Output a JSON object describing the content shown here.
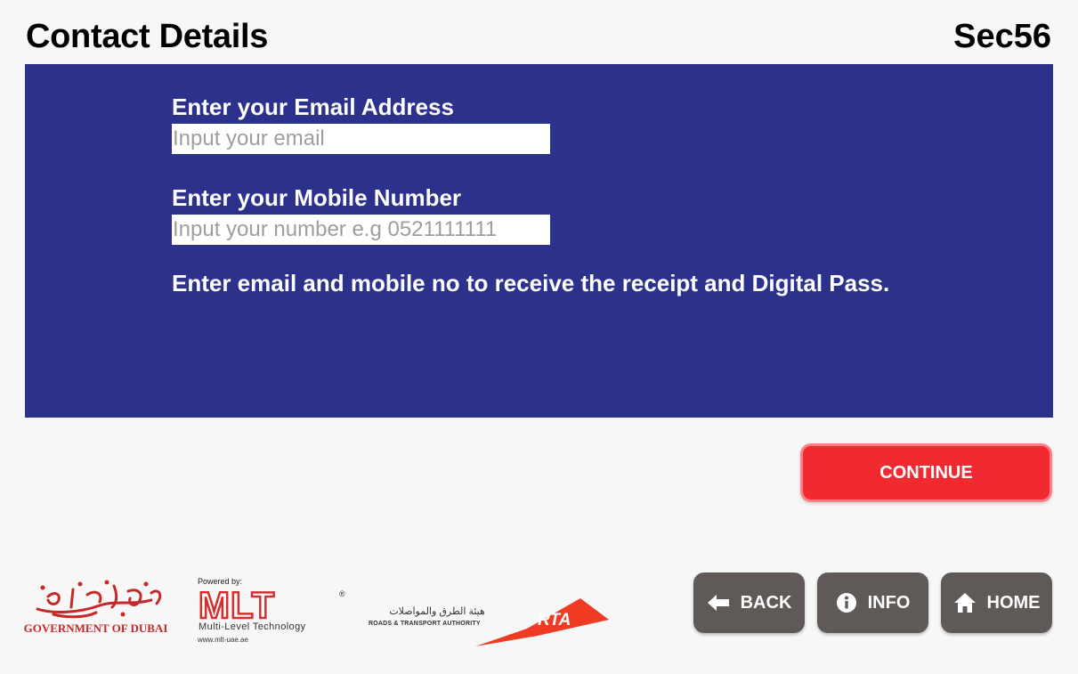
{
  "header": {
    "title": "Contact Details",
    "section_code": "Sec56"
  },
  "form": {
    "email_label": "Enter your Email Address",
    "email_placeholder": "Input your email",
    "email_value": "",
    "mobile_label": "Enter your Mobile Number",
    "mobile_placeholder": "Input your number e.g 0521111111",
    "mobile_value": "",
    "hint": "Enter email and mobile no to receive the receipt and Digital Pass."
  },
  "actions": {
    "continue_label": "CONTINUE"
  },
  "nav": {
    "back_label": "BACK",
    "info_label": "INFO",
    "home_label": "HOME"
  },
  "footer": {
    "gov_logo_text": "GOVERNMENT OF DUBAI",
    "mlt_powered": "Powered by:",
    "mlt_name": "MLT",
    "mlt_tagline": "Multi-Level Technology",
    "mlt_url": "www.mlt-uae.ae",
    "rta_arabic": "هيئة الطرق والمواصلات",
    "rta_english": "ROADS & TRANSPORT AUTHORITY",
    "rta_mark": "RTA"
  },
  "colors": {
    "panel": "#2c318c",
    "continue": "#f12a32",
    "nav_button": "#5f5a57",
    "brand_red": "#c62828"
  },
  "icons": {
    "back": "arrow-left-icon",
    "info": "info-circle-icon",
    "home": "house-icon"
  }
}
